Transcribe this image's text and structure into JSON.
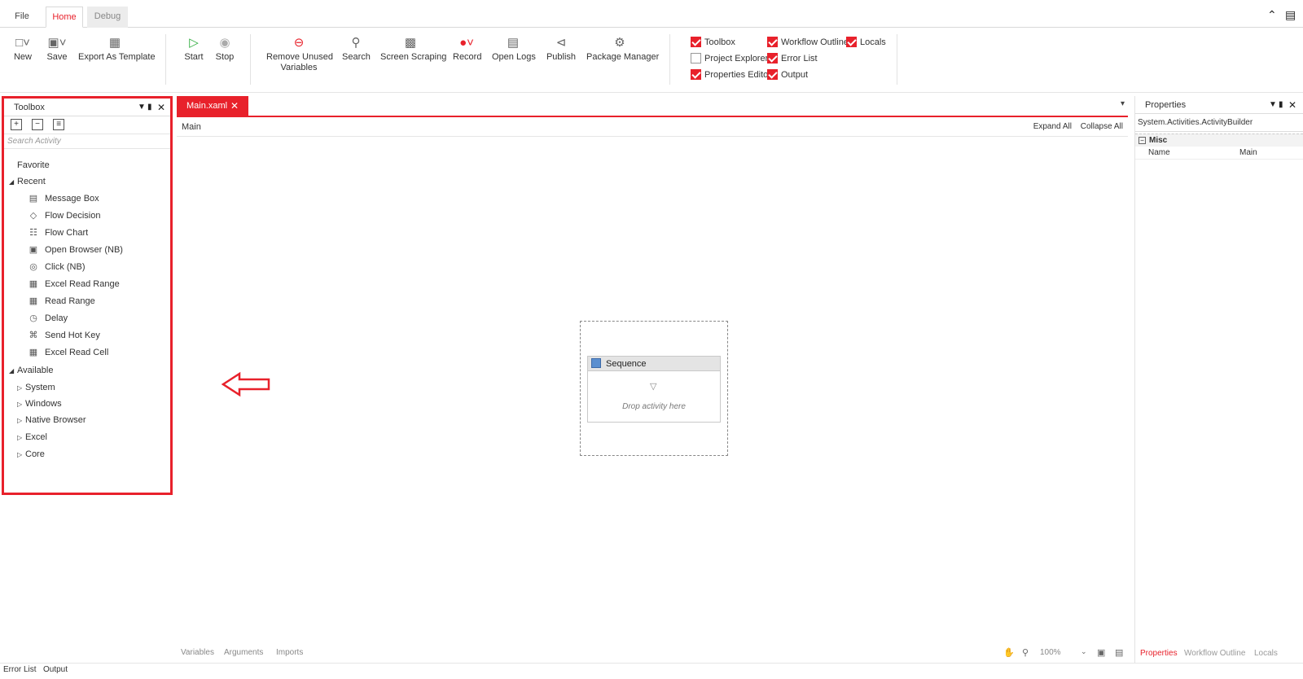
{
  "tabs": {
    "file": "File",
    "home": "Home",
    "debug": "Debug"
  },
  "window_icons": {
    "collapse": "chevron-up-icon",
    "feedback": "chat-icon"
  },
  "ribbon": {
    "new": "New",
    "save": "Save",
    "export": "Export As Template",
    "start": "Start",
    "stop": "Stop",
    "remove_unused_1": "Remove Unused",
    "remove_unused_2": "Variables",
    "search": "Search",
    "screen_scraping": "Screen Scraping",
    "record": "Record",
    "open_logs": "Open Logs",
    "publish": "Publish",
    "package_manager": "Package Manager"
  },
  "view_checks": {
    "toolbox": {
      "label": "Toolbox",
      "checked": true
    },
    "workflow_outline": {
      "label": "Workflow Outline",
      "checked": true
    },
    "locals": {
      "label": "Locals",
      "checked": true
    },
    "project_explorer": {
      "label": "Project Explorer",
      "checked": false
    },
    "error_list": {
      "label": "Error List",
      "checked": true
    },
    "properties_editor": {
      "label": "Properties Editor",
      "checked": true
    },
    "output": {
      "label": "Output",
      "checked": true
    }
  },
  "toolbox": {
    "title": "Toolbox",
    "search_placeholder": "Search Activity",
    "favorite": "Favorite",
    "recent": "Recent",
    "recent_items": [
      "Message Box",
      "Flow Decision",
      "Flow Chart",
      "Open Browser (NB)",
      "Click (NB)",
      "Excel Read Range",
      "Read Range",
      "Delay",
      "Send Hot Key",
      "Excel Read Cell"
    ],
    "available": "Available",
    "available_items": [
      "System",
      "Windows",
      "Native Browser",
      "Excel",
      "Core"
    ]
  },
  "document": {
    "tab": "Main.xaml",
    "breadcrumb": "Main",
    "expand_all": "Expand All",
    "collapse_all": "Collapse All",
    "sequence_title": "Sequence",
    "drop_hint": "Drop activity here",
    "bottom_tabs": [
      "Variables",
      "Arguments",
      "Imports"
    ],
    "zoom": "100%"
  },
  "properties": {
    "title": "Properties",
    "type": "System.Activities.ActivityBuilder",
    "category": "Misc",
    "name_key": "Name",
    "name_value": "Main",
    "tabs": [
      "Properties",
      "Workflow Outline",
      "Locals"
    ]
  },
  "statusbar": {
    "error_list": "Error List",
    "output": "Output"
  },
  "colors": {
    "accent": "#e8212b"
  }
}
